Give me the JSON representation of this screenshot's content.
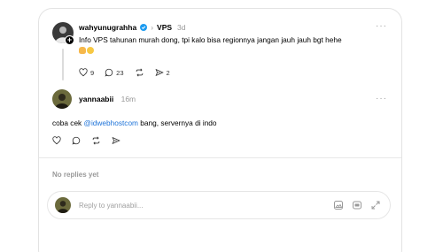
{
  "post": {
    "username": "wahyunugrahha",
    "topic": "VPS",
    "time": "3d",
    "text": "Info VPS tahunan murah dong, tpi kalo bisa regionnya jangan jauh jauh bgt hehe",
    "likes": "9",
    "comments": "23",
    "shares": "2",
    "more": "···"
  },
  "reply": {
    "username": "yannaabii",
    "time": "16m",
    "text_before": "coba cek ",
    "mention": "@idwebhostcom",
    "text_after": " bang, servernya di indo",
    "more": "···"
  },
  "replies_section": {
    "empty_text": "No replies yet"
  },
  "composer": {
    "placeholder": "Reply to yannaabii..."
  },
  "colors": {
    "accent": "#1d73d9",
    "muted": "#999999",
    "verified": "#1d9bf0"
  }
}
